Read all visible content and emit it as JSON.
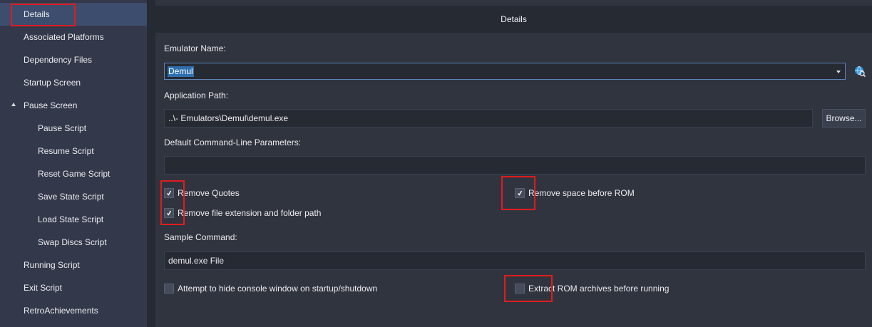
{
  "sidebar": {
    "items": [
      {
        "label": "Details"
      },
      {
        "label": "Associated Platforms"
      },
      {
        "label": "Dependency Files"
      },
      {
        "label": "Startup Screen"
      },
      {
        "label": "Pause Screen"
      },
      {
        "label": "Pause Script"
      },
      {
        "label": "Resume Script"
      },
      {
        "label": "Reset Game Script"
      },
      {
        "label": "Save State Script"
      },
      {
        "label": "Load State Script"
      },
      {
        "label": "Swap Discs Script"
      },
      {
        "label": "Running Script"
      },
      {
        "label": "Exit Script"
      },
      {
        "label": "RetroAchievements"
      }
    ]
  },
  "main": {
    "title": "Details",
    "emulator_name_label": "Emulator Name:",
    "emulator_name_value": "Demul",
    "app_path_label": "Application Path:",
    "app_path_value": "..\\- Emulators\\Demul\\demul.exe",
    "browse_label": "Browse...",
    "cmdline_label": "Default Command-Line Parameters:",
    "cmdline_value": "",
    "remove_quotes_label": "Remove Quotes",
    "remove_quotes_checked": true,
    "remove_space_label": "Remove space before ROM",
    "remove_space_checked": true,
    "remove_ext_label": "Remove file extension and folder path",
    "remove_ext_checked": true,
    "sample_cmd_label": "Sample Command:",
    "sample_cmd_value": "demul.exe File",
    "hide_console_label": "Attempt to hide console window on startup/shutdown",
    "hide_console_checked": false,
    "extract_rom_label": "Extract ROM archives before running",
    "extract_rom_checked": false
  },
  "colors": {
    "highlight": "#e01c1c",
    "selected_nav": "#3c4d6e",
    "text_selection": "#2f6fad"
  }
}
